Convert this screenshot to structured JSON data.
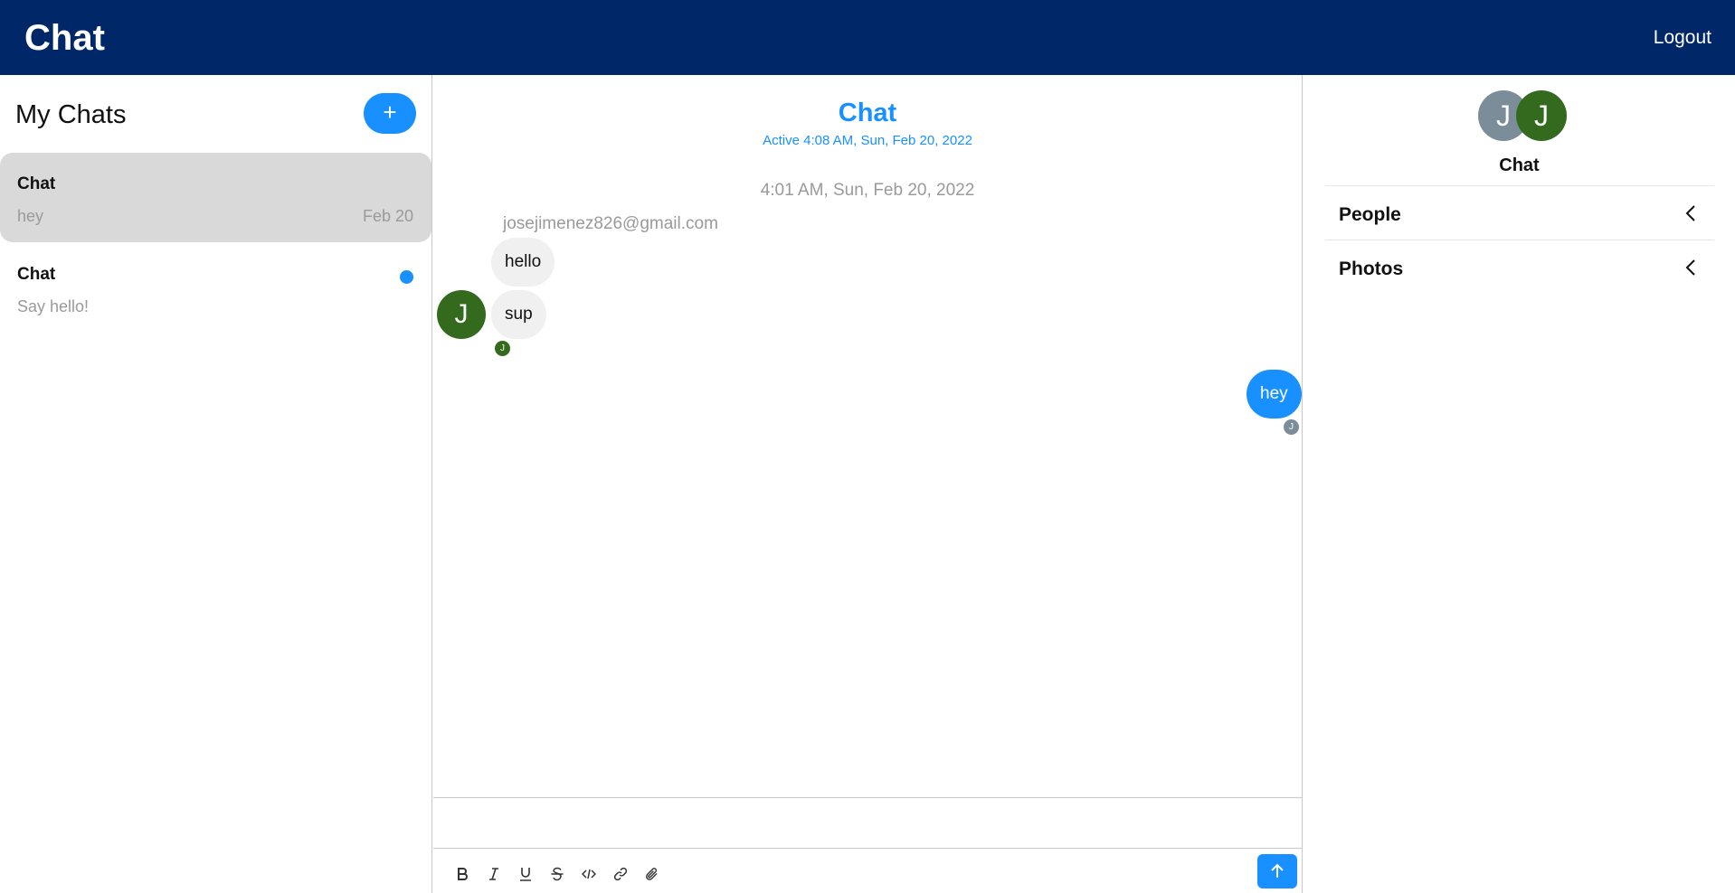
{
  "topbar": {
    "brand": "Chat",
    "logout": "Logout"
  },
  "left": {
    "title": "My Chats",
    "new_button": "+",
    "chats": [
      {
        "name": "Chat",
        "preview": "hey",
        "date": "Feb 20",
        "active": true
      },
      {
        "name": "Chat",
        "preview": "Say hello!",
        "unread": true
      }
    ]
  },
  "feed": {
    "title": "Chat",
    "active": "Active 4:08 AM, Sun, Feb 20, 2022",
    "timestamp": "4:01 AM, Sun, Feb 20, 2022",
    "sender_email": "josejimenez826@gmail.com",
    "sender_initial": "J",
    "messages": [
      {
        "text": "hello",
        "direction": "in"
      },
      {
        "text": "sup",
        "direction": "in"
      },
      {
        "text": "hey",
        "direction": "out"
      }
    ],
    "read_receipt_initial": "J",
    "toolbar_icons": [
      "bold-icon",
      "italic-icon",
      "underline-icon",
      "strikethrough-icon",
      "code-icon",
      "link-icon",
      "attachment-icon"
    ],
    "send_icon": "arrow-up-icon"
  },
  "settings": {
    "avatar_initials": [
      "J",
      "J"
    ],
    "title": "Chat",
    "sections": [
      "People",
      "Photos"
    ]
  },
  "colors": {
    "navbar": "#002868",
    "accent": "#1890ff",
    "avatar_green": "#336a1e",
    "avatar_gray": "#7a8d99"
  }
}
